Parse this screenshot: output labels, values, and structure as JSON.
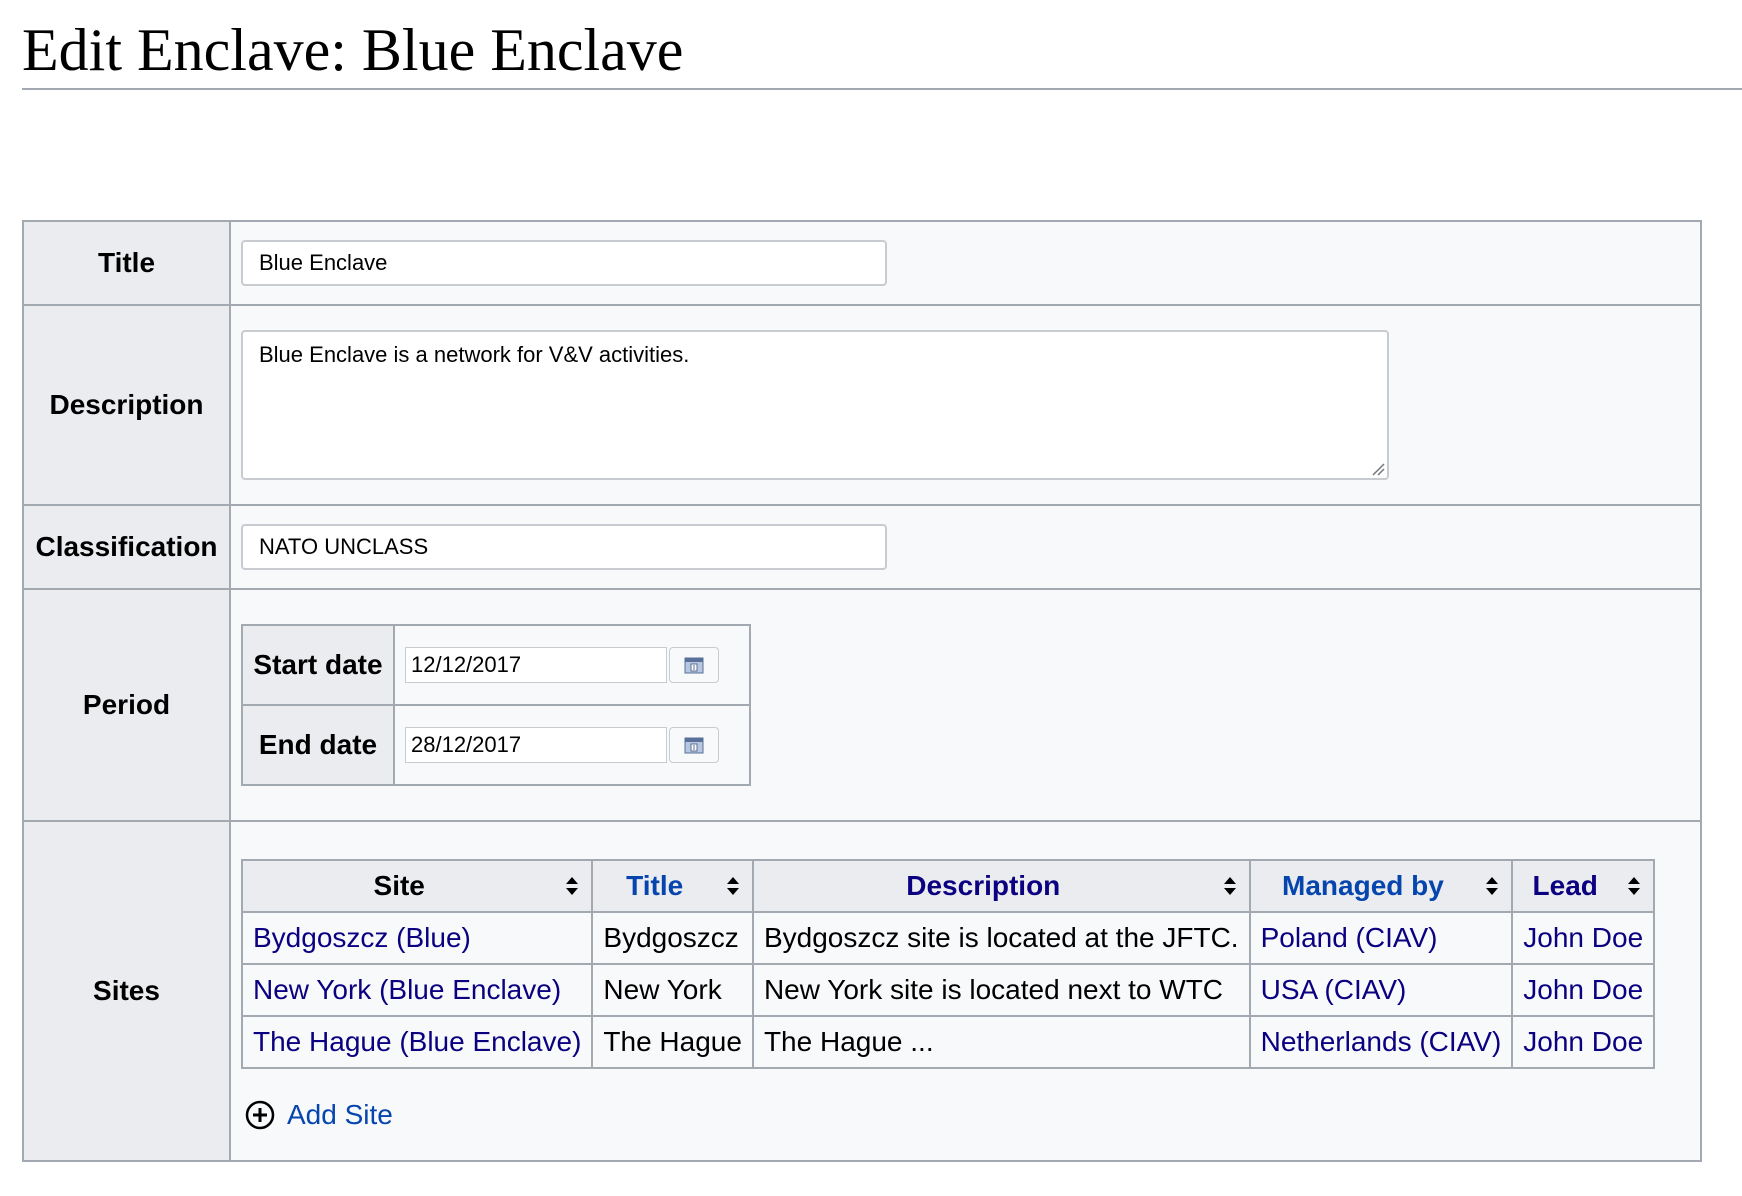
{
  "page": {
    "title": "Edit Enclave: Blue Enclave"
  },
  "form": {
    "title_label": "Title",
    "title_value": "Blue Enclave",
    "description_label": "Description",
    "description_value": "Blue Enclave is a network for V&V activities.",
    "classification_label": "Classification",
    "classification_value": "NATO UNCLASS",
    "period_label": "Period",
    "start_date_label": "Start date",
    "start_date_value": "12/12/2017",
    "end_date_label": "End date",
    "end_date_value": "28/12/2017",
    "sites_label": "Sites"
  },
  "sites": {
    "columns": [
      "Site",
      "Title",
      "Description",
      "Managed by",
      "Lead"
    ],
    "rows": [
      {
        "site": "Bydgoszcz (Blue)",
        "title": "Bydgoszcz",
        "description": "Bydgoszcz site is located at the JFTC.",
        "managed_by": "Poland (CIAV)",
        "lead": "John Doe"
      },
      {
        "site": "New York (Blue Enclave)",
        "title": "New York",
        "description": "New York site is located next to WTC",
        "managed_by": "USA (CIAV)",
        "lead": "John Doe"
      },
      {
        "site": "The Hague (Blue Enclave)",
        "title": "The Hague",
        "description": "The Hague ...",
        "managed_by": "Netherlands (CIAV)",
        "lead": "John Doe"
      }
    ],
    "add_label": "Add Site"
  },
  "icons": {
    "calendar": "calendar-icon",
    "sort": "sort-arrows-icon",
    "add": "plus-circle-icon"
  },
  "colors": {
    "link": "#0645ad",
    "visited_link": "#0b0080",
    "header_bg": "#eaecf0",
    "border": "#a2a9b1"
  }
}
